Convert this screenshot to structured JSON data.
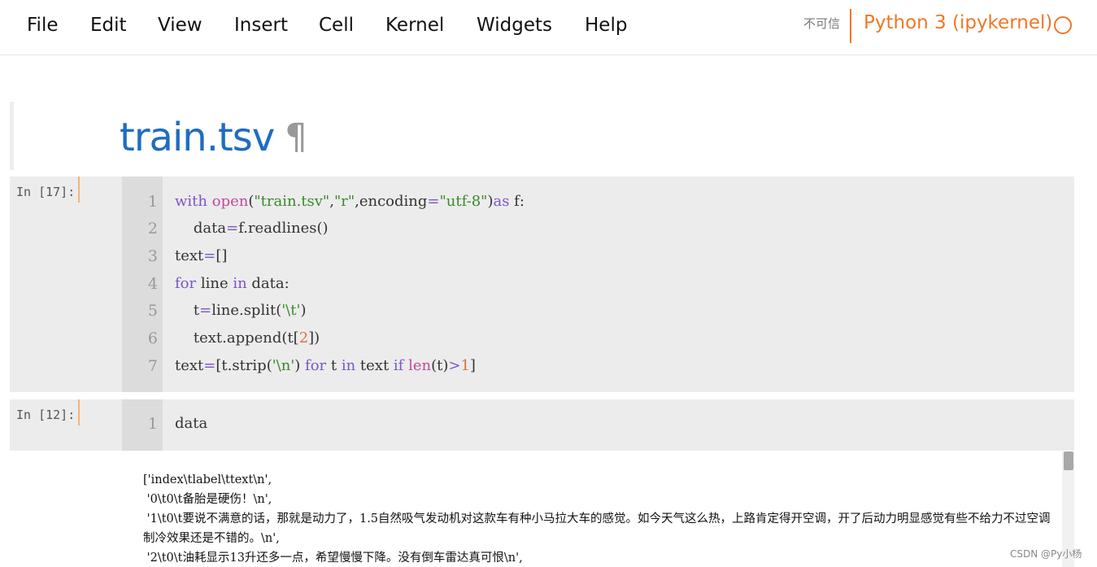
{
  "menu": {
    "items": [
      "File",
      "Edit",
      "View",
      "Insert",
      "Cell",
      "Kernel",
      "Widgets",
      "Help"
    ],
    "trust_status": "不可信",
    "kernel_name": "Python 3 (ipykernel)"
  },
  "markdown_cell": {
    "heading": "train.tsv",
    "anchor": "¶"
  },
  "cell_1": {
    "prompt": "In [17]:",
    "line_numbers": [
      "1",
      "2",
      "3",
      "4",
      "5",
      "6",
      "7"
    ],
    "code": [
      "with open(\"train.tsv\",\"r\",encoding=\"utf-8\")as f:",
      "    data=f.readlines()",
      "text=[]",
      "for line in data:",
      "    t=line.split('\\t')",
      "    text.append(t[2])",
      "text=[t.strip('\\n') for t in text if len(t)>1]"
    ]
  },
  "cell_2": {
    "prompt": "In [12]:",
    "line_numbers": [
      "1"
    ],
    "code": [
      "data"
    ]
  },
  "output_lines": [
    "['index\\tlabel\\ttext\\n',",
    " '0\\t0\\t备胎是硬伤！\\n',",
    " '1\\t0\\t要说不满意的话，那就是动力了，1.5自然吸气发动机对这款车有种小马拉大车的感觉。如今天气这么热，上路肯定得开空调，开了后动力明显感觉有些不给力不过空调制冷效果还是不错的。\\n',",
    " '2\\t0\\t油耗显示13升还多一点，希望慢慢下降。没有倒车雷达真可恨\\n',"
  ],
  "watermark": "CSDN @Py小杨",
  "colors": {
    "kernel_accent": "#f37626",
    "heading_blue": "#1f6cc4",
    "cell_bg": "#ececec",
    "keyword": "#7b55c8",
    "builtin": "#c4489c",
    "string": "#3a8a2b",
    "number": "#e0703a"
  }
}
